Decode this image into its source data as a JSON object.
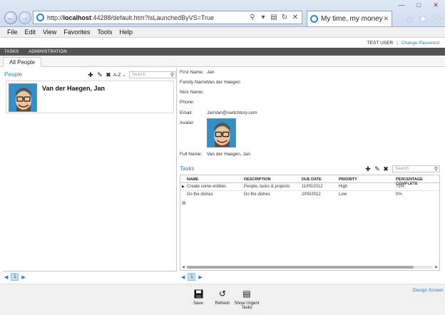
{
  "browser": {
    "url_prefix": "http://",
    "url_host": "localhost",
    "url_rest": ":44288/default.htm?IsLaunchedByVS=True",
    "tab_title": "My time, my money",
    "menu": [
      "File",
      "Edit",
      "View",
      "Favorites",
      "Tools",
      "Help"
    ]
  },
  "app": {
    "user_name": "TEST USER",
    "separator": "|",
    "change_password": "Change Password",
    "nav": [
      "TASKS",
      "ADMINISTRATION"
    ],
    "doc_tab": "All People"
  },
  "people": {
    "title": "People",
    "sort_label": "A-Z",
    "search_placeholder": "Search",
    "items": [
      {
        "name": "Van der Haegen, Jan"
      }
    ],
    "page": "1"
  },
  "details": {
    "fields": [
      {
        "label": "First Name:",
        "value": "Jan"
      },
      {
        "label": "Family Name:",
        "value": "Van der Haegen"
      },
      {
        "label": "Nick Name:",
        "value": ""
      },
      {
        "label": "Phone:",
        "value": ""
      },
      {
        "label": "Email:",
        "value": "JanVan@switchtory.com"
      }
    ],
    "avatar_label": "Avatar:",
    "full_name_label": "Full Name:",
    "full_name_value": "Van der Haegen, Jan"
  },
  "tasks": {
    "title": "Tasks",
    "search_placeholder": "Search",
    "columns": [
      "NAME",
      "DESCRIPTION",
      "DUE DATE",
      "PRIORITY",
      "PERCENTAGE COMPLETE"
    ],
    "rows": [
      [
        "Create some entities",
        "People, tasks & projects",
        "11/05/2012",
        "High",
        "75%"
      ],
      [
        "Do the dishes",
        "Do the dishes",
        "2/05/2012",
        "Low",
        "0%"
      ]
    ],
    "page": "1"
  },
  "commands": {
    "save": "Save",
    "refresh": "Refresh",
    "show_urgent": "Show Urgent Tasks",
    "design_screen": "Design Screen"
  },
  "colors": {
    "accent": "#2b7fc1",
    "nav_bg": "#535353"
  }
}
